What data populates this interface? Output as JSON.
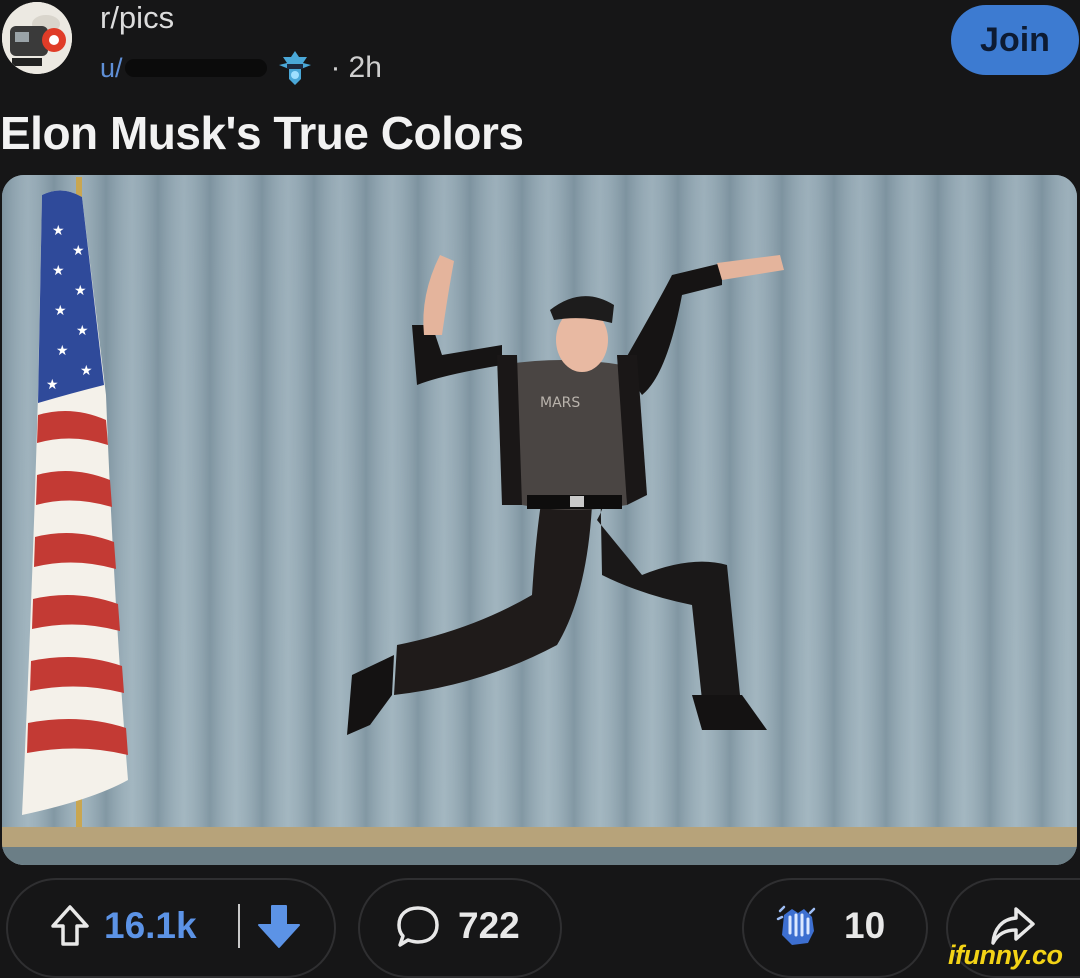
{
  "header": {
    "subreddit": "r/pics",
    "user_prefix": "u/",
    "separator": "·",
    "time_ago": "2h",
    "join_label": "Join"
  },
  "post": {
    "title": "Elon Musk's True Colors",
    "image_shirt_text": "MARS"
  },
  "actions": {
    "upvotes": "16.1k",
    "comments": "722",
    "awards": "10"
  },
  "watermark": "ifunny.co",
  "colors": {
    "background": "#161617",
    "accent": "#3d7bd1",
    "vote_count": "#5c93e6",
    "watermark": "#f3d316"
  },
  "icons": [
    "subreddit-avatar-icon",
    "user-flair-icon",
    "upvote-arrow-icon",
    "downvote-arrow-icon",
    "comment-bubble-icon",
    "clapping-award-icon",
    "share-arrow-icon"
  ]
}
